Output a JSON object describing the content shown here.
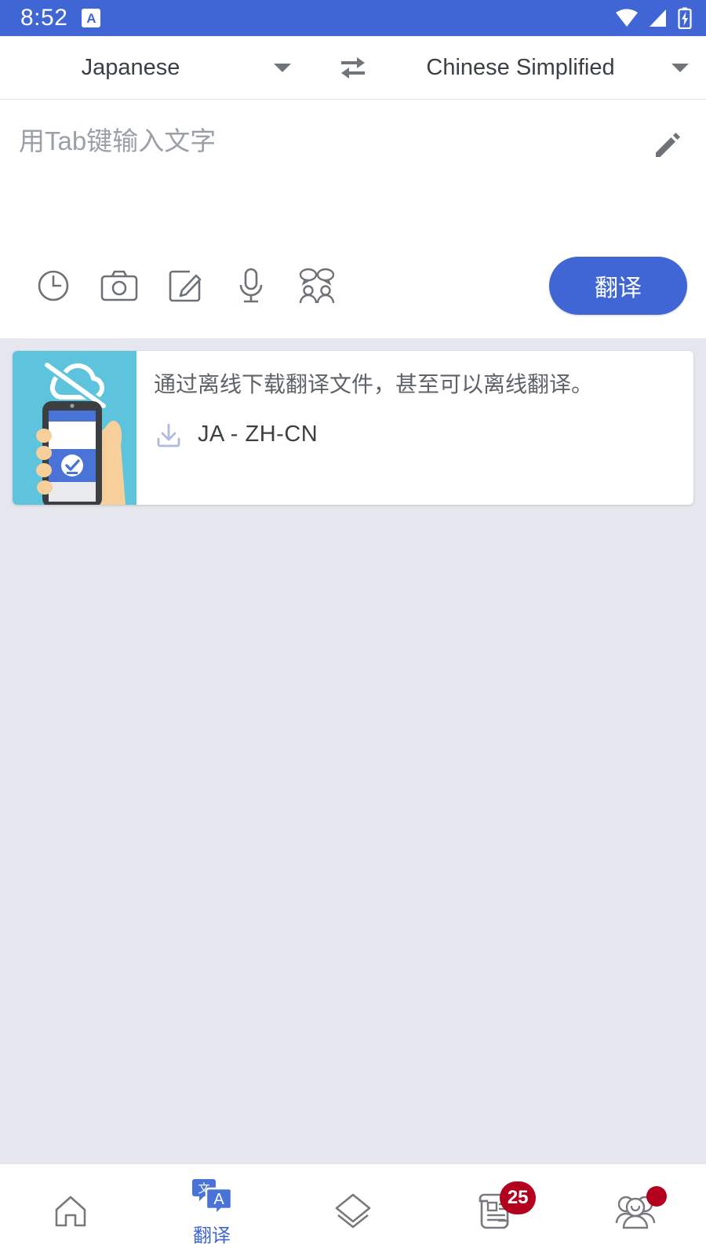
{
  "status_bar": {
    "time": "8:52",
    "app_badge": "A",
    "icons": [
      "wifi-icon",
      "cellular-signal-icon",
      "battery-charging-icon"
    ],
    "background_color": "#3f66d4"
  },
  "language_bar": {
    "source_language": "Japanese",
    "target_language": "Chinese Simplified",
    "swap_icon": "swap-horizontal-icon",
    "dropdown_icon": "caret-down-icon"
  },
  "input_area": {
    "placeholder": "用Tab键输入文字",
    "value": "",
    "edit_icon": "pencil-icon",
    "tools": [
      {
        "name": "history-icon",
        "label": "History"
      },
      {
        "name": "camera-icon",
        "label": "Camera"
      },
      {
        "name": "handwriting-icon",
        "label": "Handwriting"
      },
      {
        "name": "microphone-icon",
        "label": "Voice"
      },
      {
        "name": "conversation-icon",
        "label": "Conversation"
      }
    ],
    "translate_button": "翻译"
  },
  "offline_card": {
    "message": "通过离线下载翻译文件，甚至可以离线翻译。",
    "download_label": "JA - ZH-CN",
    "download_icon": "download-icon",
    "illustration": {
      "name": "offline-phone-illustration",
      "background_color": "#5ec3dd",
      "cloud_off_icon": "cloud-off-icon"
    }
  },
  "bottom_nav": {
    "items": [
      {
        "name": "home",
        "icon": "home-icon",
        "label": "",
        "badge": "",
        "active": false
      },
      {
        "name": "translate",
        "icon": "translate-icon",
        "label": "翻译",
        "badge": "",
        "active": true
      },
      {
        "name": "cards",
        "icon": "layers-icon",
        "label": "",
        "badge": "",
        "active": false
      },
      {
        "name": "feed",
        "icon": "news-scroll-icon",
        "label": "",
        "badge": "25",
        "active": false
      },
      {
        "name": "community",
        "icon": "people-group-icon",
        "label": "",
        "badge": "dot",
        "active": false
      }
    ]
  },
  "colors": {
    "accent": "#3f66d4",
    "badge": "#b3001e",
    "illustration_teal": "#5ec3dd",
    "page_background": "#e6e6ee"
  }
}
